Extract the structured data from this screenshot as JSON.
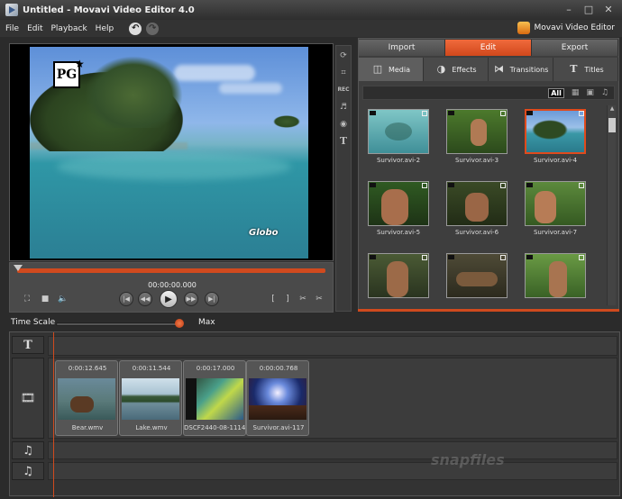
{
  "window": {
    "title": "Untitled - Movavi Video Editor 4.0",
    "controls": [
      "–",
      "□",
      "✕"
    ]
  },
  "menu": {
    "items": [
      "File",
      "Edit",
      "Playback",
      "Help"
    ],
    "brand": "Movavi Video Editor"
  },
  "preview": {
    "badge": "PG",
    "channel_logo": "Globo"
  },
  "side_tools": [
    "rotate-icon",
    "crop-icon",
    "record-icon",
    "audio-icon",
    "color-icon",
    "title-icon"
  ],
  "side_tool_labels": {
    "record": "REC",
    "title": "T"
  },
  "player": {
    "timecode": "00:00:00.000",
    "progress": 0.0
  },
  "tabs": [
    {
      "label": "Import"
    },
    {
      "label": "Edit"
    },
    {
      "label": "Export"
    }
  ],
  "subtabs": [
    {
      "label": "Media"
    },
    {
      "label": "Effects"
    },
    {
      "label": "Transitions"
    },
    {
      "label": "Titles",
      "icon_text": "T"
    }
  ],
  "filter": {
    "all": "All"
  },
  "media": [
    {
      "name": "Survivor.avi-2"
    },
    {
      "name": "Survivor.avi-3"
    },
    {
      "name": "Survivor.avi-4"
    },
    {
      "name": "Survivor.avi-5"
    },
    {
      "name": "Survivor.avi-6"
    },
    {
      "name": "Survivor.avi-7"
    }
  ],
  "timescale": {
    "label": "Time Scale",
    "max_label": "Max"
  },
  "timeline": {
    "title_track_icon": "T",
    "clips": [
      {
        "duration": "0:00:12.645",
        "name": "Bear.wmv"
      },
      {
        "duration": "0:00:11.544",
        "name": "Lake.wmv"
      },
      {
        "duration": "0:00:17.000",
        "name": "DSCF2440-08-1114..."
      },
      {
        "duration": "0:00:00.768",
        "name": "Survivor.avi-117"
      }
    ]
  },
  "watermark": "snapfiles",
  "colors": {
    "accent": "#d04a1e",
    "background": "#2b2b2b"
  }
}
